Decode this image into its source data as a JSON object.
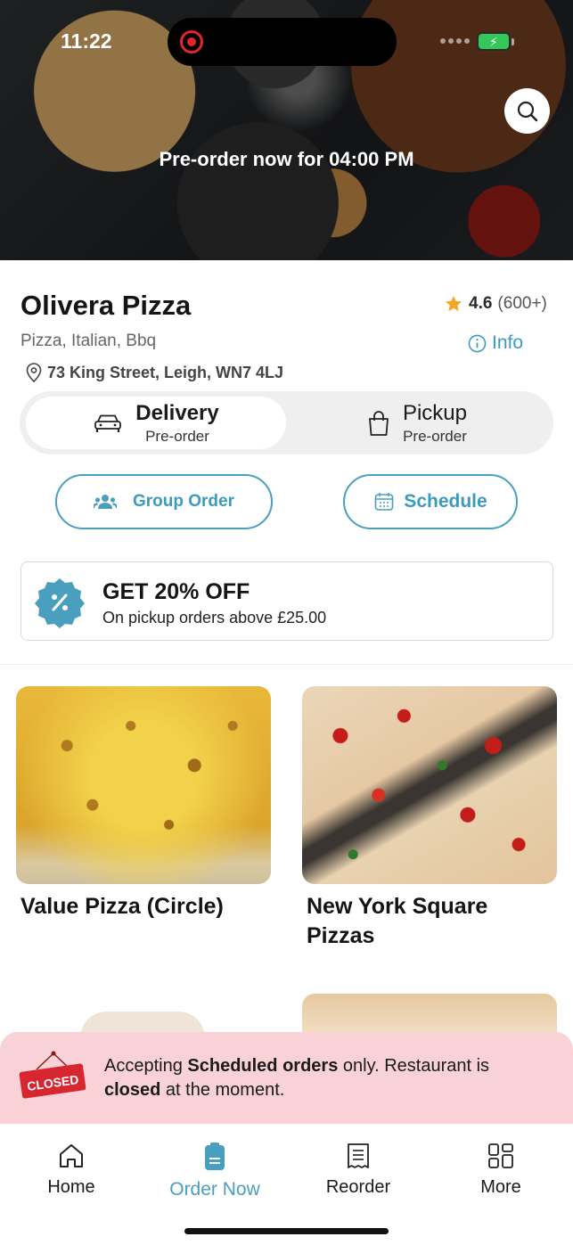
{
  "status_bar": {
    "time": "11:22"
  },
  "hero": {
    "preorder_text": "Pre-order now for 04:00 PM"
  },
  "restaurant": {
    "name": "Olivera Pizza",
    "rating": "4.6",
    "rating_count": "(600+)",
    "cuisine": "Pizza, Italian, Bbq",
    "info_label": "Info",
    "address": "73 King Street, Leigh, WN7 4LJ"
  },
  "mode_toggle": {
    "delivery": {
      "title": "Delivery",
      "subtitle": "Pre-order",
      "selected": true
    },
    "pickup": {
      "title": "Pickup",
      "subtitle": "Pre-order",
      "selected": false
    }
  },
  "actions": {
    "group_order": "Group Order",
    "schedule": "Schedule"
  },
  "promo": {
    "title": "GET 20% OFF",
    "subtitle": "On pickup orders above £25.00"
  },
  "menu_categories": [
    {
      "name": "Value Pizza (Circle)"
    },
    {
      "name": "New York Square Pizzas"
    }
  ],
  "closed_notice": {
    "sign_text": "CLOSED",
    "part1": "Accepting ",
    "bold1": "Scheduled orders",
    "part2": " only. Restaurant is ",
    "bold2": "closed",
    "part3": " at the moment."
  },
  "tab_bar": {
    "home": "Home",
    "order_now": "Order Now",
    "reorder": "Reorder",
    "more": "More",
    "active": "order_now"
  },
  "colors": {
    "accent": "#4a9fbf",
    "star": "#f5a623",
    "closed_bg": "#f8d2d6",
    "closed_sign": "#d7262f",
    "battery": "#34c759"
  }
}
